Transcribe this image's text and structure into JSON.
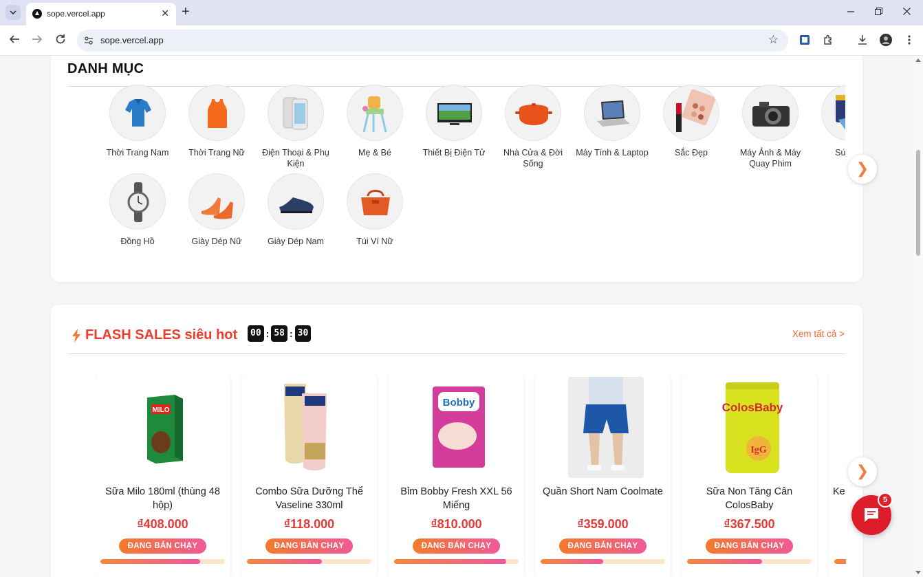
{
  "browser": {
    "tab_title": "sope.vercel.app",
    "url": "sope.vercel.app",
    "new_tab": "+",
    "close_tab": "✕"
  },
  "categories": {
    "title": "DANH MỤC",
    "items": [
      {
        "label": "Thời Trang Nam",
        "icon": "polo-shirt-image"
      },
      {
        "label": "Thời Trang Nữ",
        "icon": "tank-top-image"
      },
      {
        "label": "Điện Thoại & Phụ Kiện",
        "icon": "smartphone-image"
      },
      {
        "label": "Mẹ & Bé",
        "icon": "high-chair-image"
      },
      {
        "label": "Thiết Bị Điện Tử",
        "icon": "tv-image"
      },
      {
        "label": "Nhà Cửa & Đời Sống",
        "icon": "cooking-pot-image"
      },
      {
        "label": "Máy Tính & Laptop",
        "icon": "laptop-image"
      },
      {
        "label": "Sắc Đẹp",
        "icon": "makeup-image"
      },
      {
        "label": "Máy Ảnh & Máy Quay Phim",
        "icon": "camera-image"
      },
      {
        "label": "Sức Kh",
        "icon": "health-image"
      },
      {
        "label": "Đồng Hồ",
        "icon": "watch-image"
      },
      {
        "label": "Giày Dép Nữ",
        "icon": "heels-image"
      },
      {
        "label": "Giày Dép Nam",
        "icon": "men-shoe-image"
      },
      {
        "label": "Túi Ví Nữ",
        "icon": "handbag-image"
      }
    ]
  },
  "flash_sale": {
    "title": "FLASH SALES siêu hot",
    "timer": {
      "hours": "00",
      "minutes": "58",
      "seconds": "30"
    },
    "see_all": "Xem tất cả >",
    "products": [
      {
        "name": "Sữa Milo 180ml (thùng 48 hộp)",
        "price": "₫408.000",
        "badge": "ĐANG BÁN CHẠY",
        "sold_fraction": 0.8
      },
      {
        "name": "Combo Sữa Dưỡng Thể Vaseline 330ml",
        "price": "₫118.000",
        "badge": "ĐANG BÁN CHẠY",
        "sold_fraction": 0.6
      },
      {
        "name": "Bỉm Bobby Fresh XXL 56 Miếng",
        "price": "₫810.000",
        "badge": "ĐANG BÁN CHẠY",
        "sold_fraction": 0.9
      },
      {
        "name": "Quần Short Nam Coolmate",
        "price": "₫359.000",
        "badge": "ĐANG BÁN CHẠY",
        "sold_fraction": 0.5
      },
      {
        "name": "Sữa Non Tăng Cân ColosBaby",
        "price": "₫367.500",
        "badge": "ĐANG BÁN CHẠY",
        "sold_fraction": 0.6
      },
      {
        "name": "Ke",
        "price": "",
        "badge": "",
        "sold_fraction": 0.5
      }
    ]
  },
  "chat": {
    "badge_count": "5"
  }
}
